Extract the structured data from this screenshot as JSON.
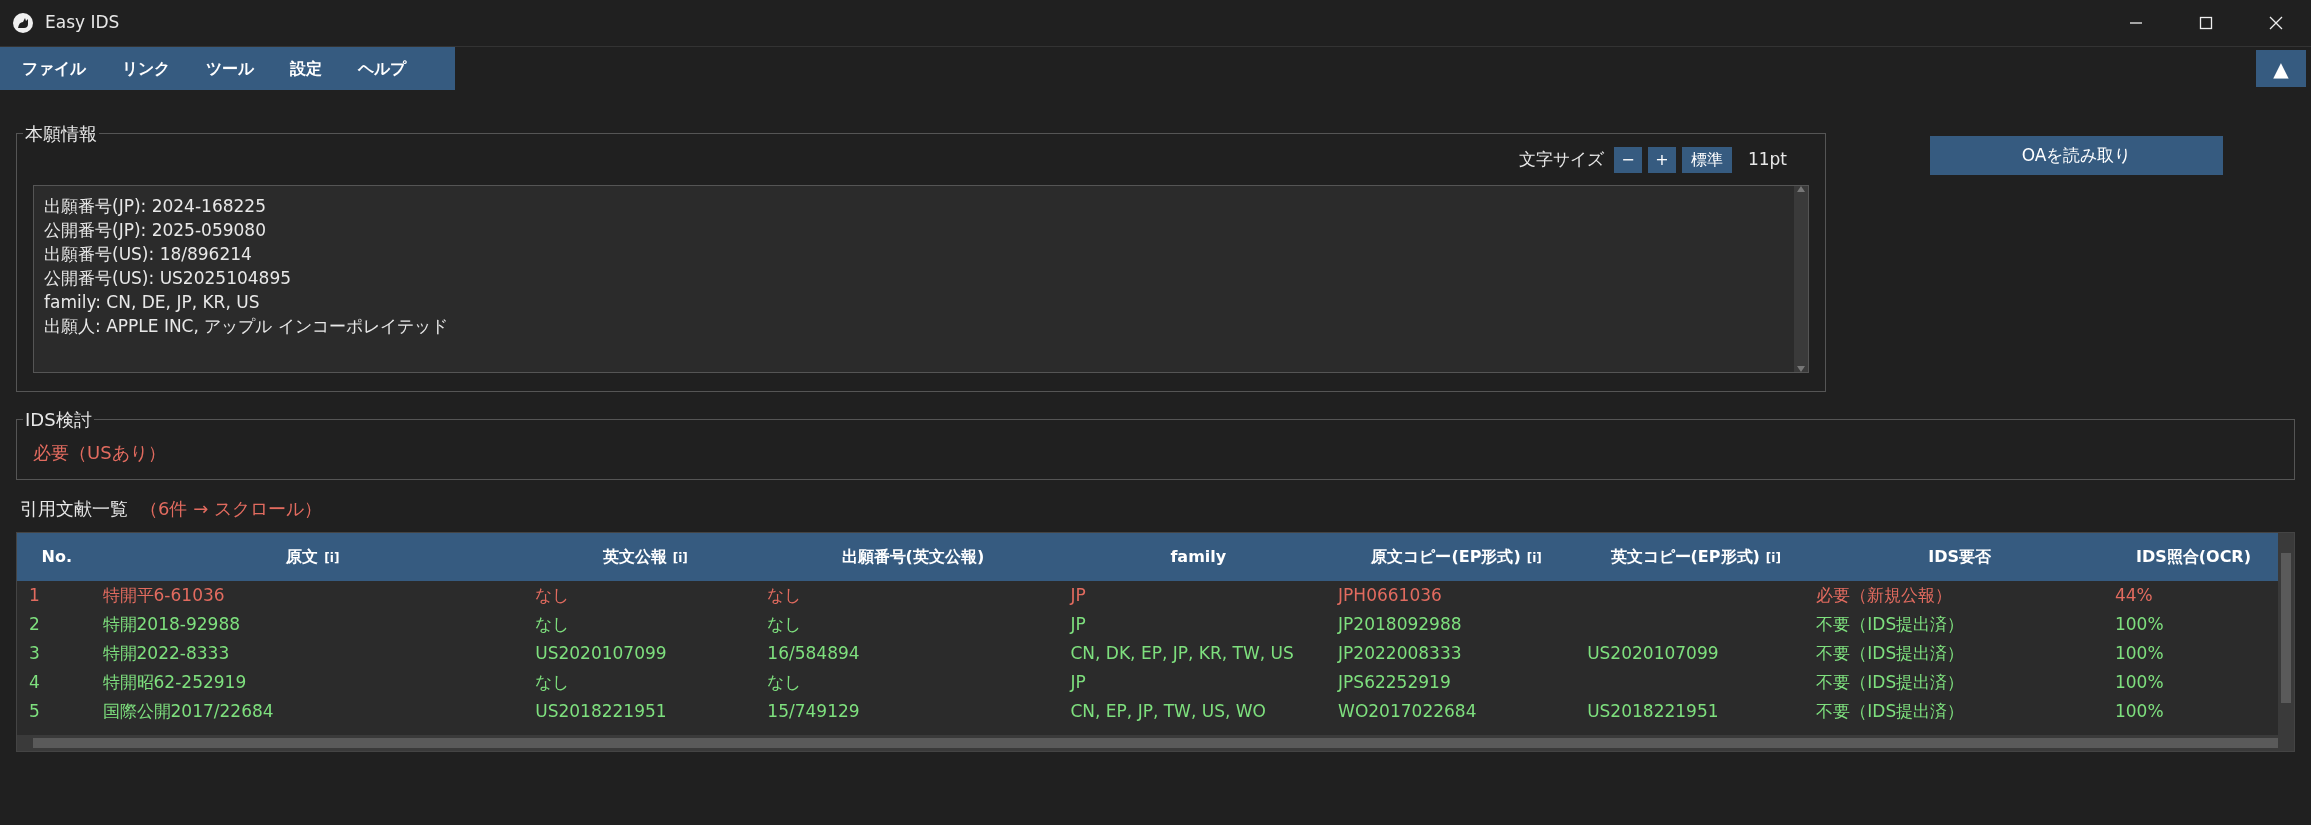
{
  "window": {
    "title": "Easy IDS"
  },
  "menu": [
    "ファイル",
    "リンク",
    "ツール",
    "設定",
    "ヘルプ"
  ],
  "collapse_button": "▲",
  "application_info": {
    "title": "本願情報",
    "font_size_label": "文字サイズ",
    "buttons": [
      "−",
      "+",
      "標準"
    ],
    "font_size": "11pt",
    "lines": [
      "出願番号(JP): 2024-168225",
      "公開番号(JP): 2025-059080",
      "出願番号(US): 18/896214",
      "公開番号(US): US2025104895",
      "family: CN, DE, JP, KR, US",
      "出願人: APPLE INC, アップル インコーポレイテッド"
    ]
  },
  "oa_button": "OAを読み取り",
  "ids_review": {
    "title": "IDS検討",
    "result": "必要（USあり）"
  },
  "citations": {
    "title": "引用文献一覧",
    "note": "（6件 → スクロール）",
    "table": {
      "columns": [
        {
          "label": "No."
        },
        {
          "label": "原文",
          "info": "[i]"
        },
        {
          "label": "英文公報",
          "info": "[i]"
        },
        {
          "label": "出願番号(英文公報)"
        },
        {
          "label": "family"
        },
        {
          "label": "原文コピー(EP形式)",
          "info": "[i]"
        },
        {
          "label": "英文コピー(EP形式)",
          "info": "[i]"
        },
        {
          "label": "IDS要否"
        },
        {
          "label": "IDS照合(OCR)"
        }
      ],
      "rows": [
        {
          "required": true,
          "cells": [
            "1",
            "特開平6-61036",
            "なし",
            "なし",
            "JP",
            "JPH0661036",
            "",
            "必要（新規公報）",
            "44%"
          ]
        },
        {
          "required": false,
          "cells": [
            "2",
            "特開2018-92988",
            "なし",
            "なし",
            "JP",
            "JP2018092988",
            "",
            "不要（IDS提出済）",
            "100%"
          ]
        },
        {
          "required": false,
          "cells": [
            "3",
            "特開2022-8333",
            "US2020107099",
            "16/584894",
            "CN, DK, EP, JP, KR, TW, US",
            "JP2022008333",
            "US2020107099",
            "不要（IDS提出済）",
            "100%"
          ]
        },
        {
          "required": false,
          "cells": [
            "4",
            "特開昭62-252919",
            "なし",
            "なし",
            "JP",
            "JPS62252919",
            "",
            "不要（IDS提出済）",
            "100%"
          ]
        },
        {
          "required": false,
          "cells": [
            "5",
            "国際公開2017/22684",
            "US2018221951",
            "15/749129",
            "CN, EP, JP, TW, US, WO",
            "WO2017022684",
            "US2018221951",
            "不要（IDS提出済）",
            "100%"
          ]
        }
      ]
    }
  }
}
